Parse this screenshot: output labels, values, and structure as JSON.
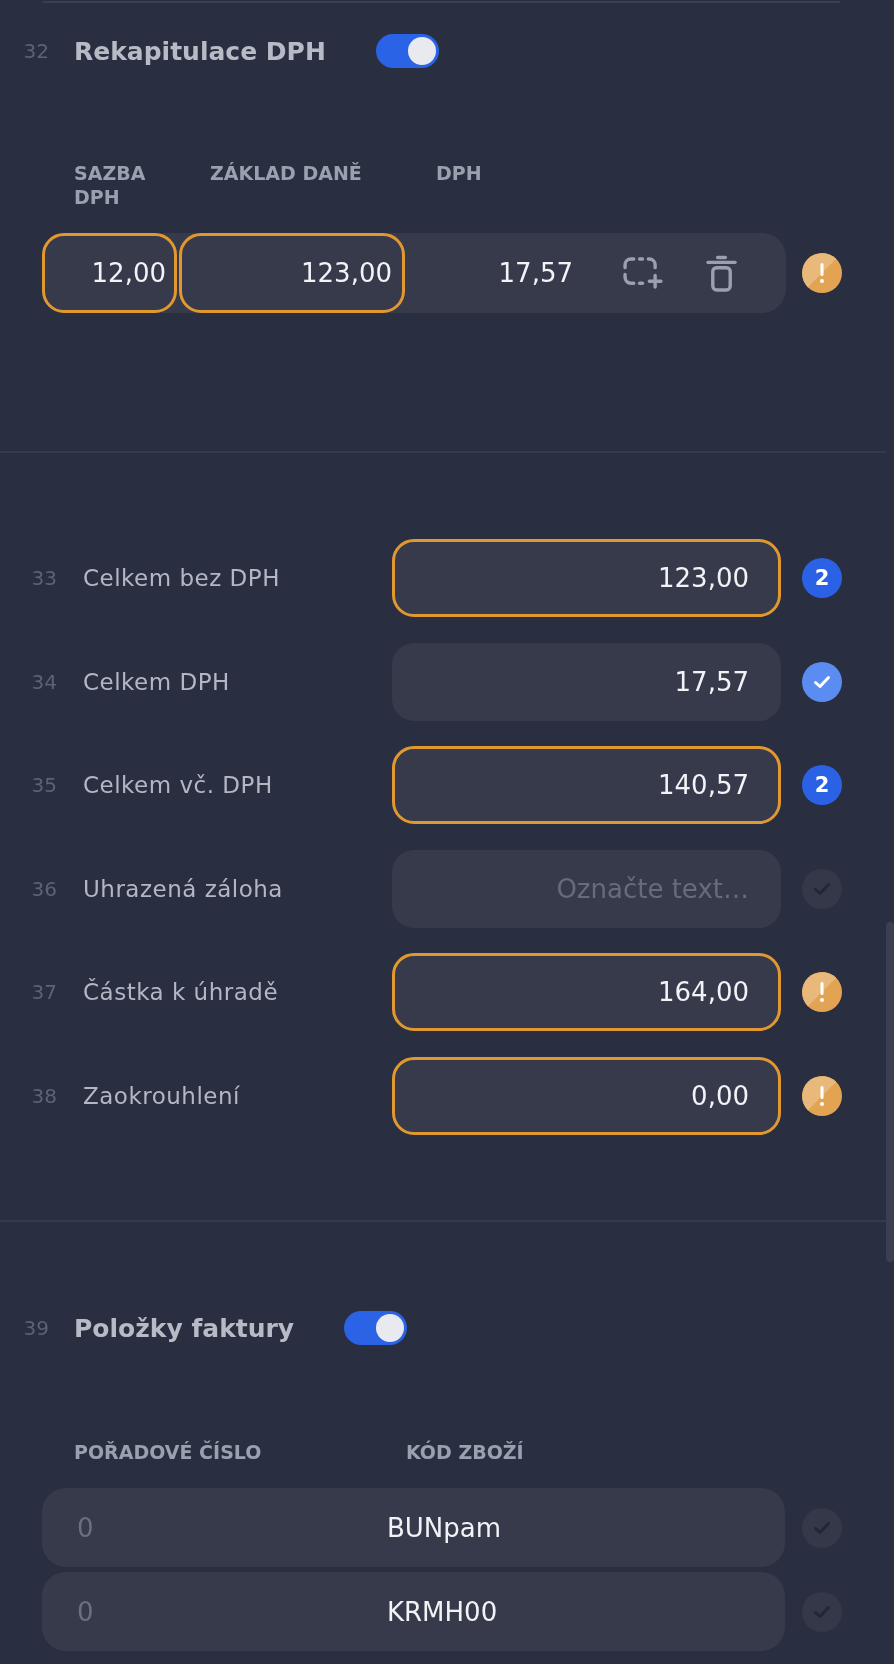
{
  "vat_section": {
    "number": "32",
    "title": "Rekapitulace DPH",
    "toggle_on": true,
    "columns": [
      "SAZBA DPH",
      "ZÁKLAD DANĚ",
      "DPH"
    ],
    "rows": [
      {
        "cells": [
          {
            "kind": "input",
            "value": "12,00",
            "highlighted": true
          },
          {
            "kind": "input",
            "value": "123,00",
            "highlighted": true
          },
          {
            "kind": "text",
            "value": "17,57"
          }
        ],
        "indicator": {
          "kind": "warning"
        }
      }
    ]
  },
  "totals": [
    {
      "number": "33",
      "label": "Celkem bez DPH",
      "value": "123,00",
      "highlighted": true,
      "indicator": {
        "kind": "count",
        "text": "2"
      }
    },
    {
      "number": "34",
      "label": "Celkem DPH",
      "value": "17,57",
      "highlighted": false,
      "indicator": {
        "kind": "confirmed"
      }
    },
    {
      "number": "35",
      "label": "Celkem vč. DPH",
      "value": "140,57",
      "highlighted": true,
      "indicator": {
        "kind": "count",
        "text": "2"
      }
    },
    {
      "number": "36",
      "label": "Uhrazená záloha",
      "placeholder": "Označte text…",
      "highlighted": false,
      "indicator": {
        "kind": "unconfirmed"
      }
    },
    {
      "number": "37",
      "label": "Částka k úhradě",
      "value": "164,00",
      "highlighted": true,
      "indicator": {
        "kind": "warning"
      }
    },
    {
      "number": "38",
      "label": "Zaokrouhlení",
      "value": "0,00",
      "highlighted": true,
      "indicator": {
        "kind": "warning"
      }
    }
  ],
  "items_section": {
    "number": "39",
    "title": "Položky faktury",
    "toggle_on": true,
    "columns": [
      "POŘADOVÉ ČÍSLO",
      "KÓD ZBOŽÍ"
    ],
    "rows": [
      {
        "order": "0",
        "code": "BUNpam",
        "indicator": {
          "kind": "unconfirmed"
        }
      },
      {
        "order": "0",
        "code": "KRMH00",
        "indicator": {
          "kind": "unconfirmed"
        }
      }
    ]
  }
}
